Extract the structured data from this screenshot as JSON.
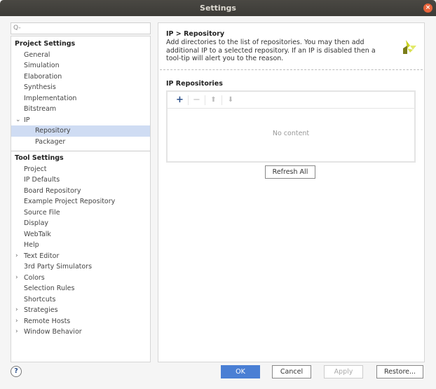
{
  "window": {
    "title": "Settings",
    "close": "×"
  },
  "search": {
    "placeholder": "Q-"
  },
  "tree": {
    "project_header": "Project Settings",
    "project_items": [
      "General",
      "Simulation",
      "Elaboration",
      "Synthesis",
      "Implementation",
      "Bitstream"
    ],
    "ip": "IP",
    "ip_children": [
      "Repository",
      "Packager"
    ],
    "tool_header": "Tool Settings",
    "tool_items": [
      {
        "label": "Project"
      },
      {
        "label": "IP Defaults"
      },
      {
        "label": "Board Repository"
      },
      {
        "label": "Example Project Repository"
      },
      {
        "label": "Source File"
      },
      {
        "label": "Display"
      },
      {
        "label": "WebTalk"
      },
      {
        "label": "Help"
      },
      {
        "label": "Text Editor",
        "expandable": true
      },
      {
        "label": "3rd Party Simulators"
      },
      {
        "label": "Colors",
        "expandable": true
      },
      {
        "label": "Selection Rules"
      },
      {
        "label": "Shortcuts"
      },
      {
        "label": "Strategies",
        "expandable": true
      },
      {
        "label": "Remote Hosts",
        "expandable": true
      },
      {
        "label": "Window Behavior",
        "expandable": true
      }
    ]
  },
  "panel": {
    "title": "IP > Repository",
    "description": "Add directories to the list of repositories. You may then add additional IP to a selected repository. If an IP is disabled then a tool-tip will alert you to the reason.",
    "section": "IP Repositories",
    "empty": "No content",
    "refresh": "Refresh All"
  },
  "buttons": {
    "ok": "OK",
    "cancel": "Cancel",
    "apply": "Apply",
    "restore": "Restore...",
    "help": "?"
  },
  "colors": {
    "accent": "#4a7fd4",
    "selection": "#cfdcf3"
  }
}
